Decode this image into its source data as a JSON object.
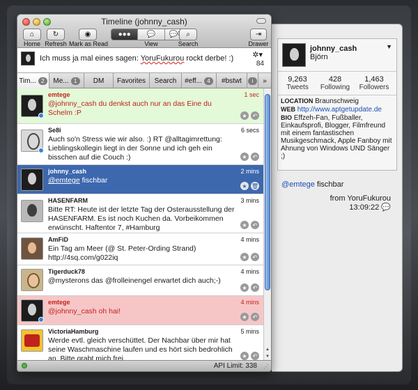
{
  "window": {
    "title": "Timeline (johnny_cash)"
  },
  "toolbar": {
    "home": "Home",
    "refresh": "Refresh",
    "mark_as_read": "Mark as Read",
    "view": "View",
    "search": "Search",
    "drawer": "Drawer"
  },
  "compose": {
    "text_before": "Ich muss ja mal eines sagen: ",
    "text_link": "YoruFukurou",
    "text_after": " rockt derbe! :)",
    "char_count": "84"
  },
  "tabs": [
    {
      "label": "Tim...",
      "badge": "2"
    },
    {
      "label": "Me...",
      "badge": "1"
    },
    {
      "label": "DM",
      "badge": ""
    },
    {
      "label": "Favorites",
      "badge": ""
    },
    {
      "label": "Search",
      "badge": ""
    },
    {
      "label": "#eff...",
      "badge": "4"
    },
    {
      "label": "#bstwt",
      "badge": ""
    }
  ],
  "tweets": [
    {
      "user": "emtege",
      "time": "1 sec",
      "text": "@johnny_cash du denkst auch nur an das Eine du Schelm :P"
    },
    {
      "user": "Se8i",
      "time": "6 secs",
      "text": "Auch so'n Stress wie wir also. :) RT @alltagimrettung: Lieblingskollegin liegt in der Sonne und ich geh ein bisschen auf die Couch :)"
    },
    {
      "user": "johnny_cash",
      "time": "2 mins",
      "text_user": "@emtege",
      "text_rest": " fischbar"
    },
    {
      "user": "HASENFARM",
      "time": "3 mins",
      "text": "Bitte RT: Heute ist der letzte Tag der Osterausstellung der HASENFARM. Es ist noch Kuchen da. Vorbeikommen erwünscht. Haftentor 7, #Hamburg"
    },
    {
      "user": "AmFiD",
      "time": "4 mins",
      "text": "Ein Tag am Meer (@ St. Peter-Ording Strand) http://4sq.com/g022iq"
    },
    {
      "user": "Tigerduck78",
      "time": "4 mins",
      "text": "@mysterons das @frolleinengel erwartet dich auch;-)"
    },
    {
      "user": "emtege",
      "time": "4 mins",
      "text": "@johnny_cash oh hai!"
    },
    {
      "user": "VictoriaHamburg",
      "time": "5 mins",
      "text": "Werde evtl. gleich verschüttet. Der Nachbar über mir hat seine Waschmaschine laufen und es hört sich bedrohlich an. Bitte grabt mich frei."
    }
  ],
  "status": {
    "api_limit": "API Limit: 338"
  },
  "profile": {
    "username": "johnny_cash",
    "realname": "Björn",
    "tweets_count": "9,263",
    "tweets_label": "Tweets",
    "following_count": "428",
    "following_label": "Following",
    "followers_count": "1,463",
    "followers_label": "Followers",
    "location_key": "LOCATION",
    "location_value": "Braunschweig",
    "web_key": "WEB",
    "web_value": "http://www.aptgetupdate.de",
    "bio_key": "BIO",
    "bio_value": "Effzeh-Fan, Fußballer, Einkaufsprofi, Blogger, Filmfreund mit einem fantastischen Musikgeschmack, Apple Fanboy mit Ahnung von Windows UND Sänger ;)"
  },
  "drawer_tweet": {
    "user": "@emtege",
    "rest": " fischbar",
    "from": "from YoruFukurou",
    "time": "13:09:22"
  },
  "colors": {
    "selected_row": "#3d68ae",
    "mention_green": "#e3f9d8",
    "mention_red": "#f6c6c7",
    "mention_text": "#c1241b",
    "link": "#1b4fb3"
  }
}
